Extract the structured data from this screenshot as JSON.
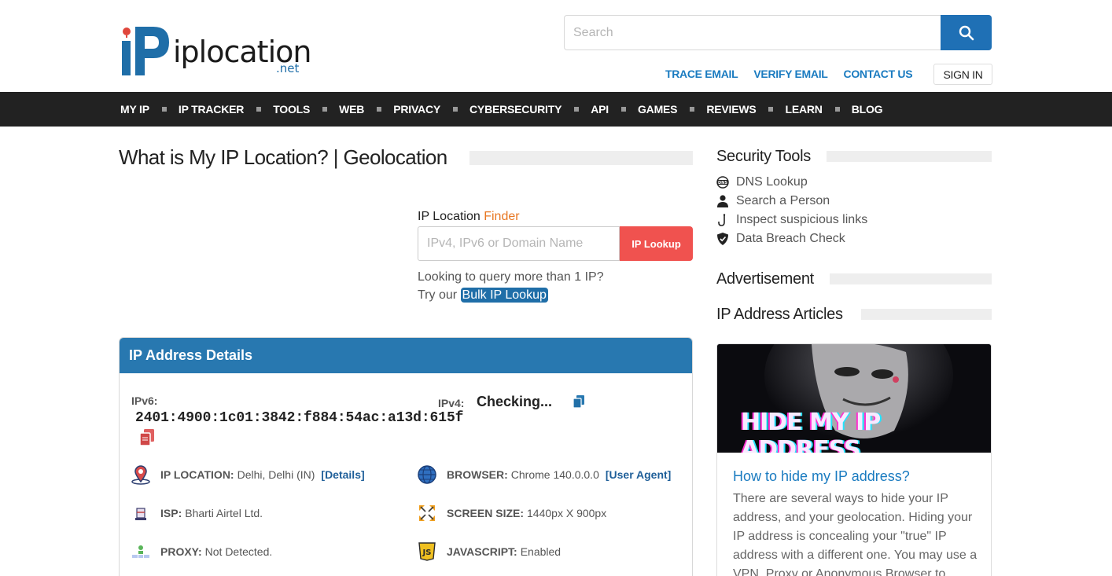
{
  "brand": {
    "name": "iplocation",
    "suffix": ".net"
  },
  "search": {
    "placeholder": "Search"
  },
  "top_links": [
    "TRACE EMAIL",
    "VERIFY EMAIL",
    "CONTACT US"
  ],
  "sign_in": "SIGN IN",
  "nav": [
    "MY IP",
    "IP TRACKER",
    "TOOLS",
    "WEB",
    "PRIVACY",
    "CYBERSECURITY",
    "API",
    "GAMES",
    "REVIEWS",
    "LEARN",
    "BLOG"
  ],
  "main": {
    "title": "What is My IP Location? | Geolocation",
    "finder": {
      "label_prefix": "IP Location ",
      "label_accent": "Finder",
      "placeholder": "IPv4, IPv6 or Domain Name",
      "button": "IP Lookup"
    },
    "bulk": {
      "line1": "Looking to query more than 1 IP?",
      "line2_prefix": "Try our ",
      "link": "Bulk IP Lookup"
    }
  },
  "details": {
    "header": "IP Address Details",
    "ipv6_label": "IPv6:",
    "ipv6_value": "2401:4900:1c01:3842:f884:54ac:a13d:615f",
    "ipv4_label": "IPv4:",
    "ipv4_value": "Checking...",
    "ip_location_label": "IP LOCATION:",
    "ip_location_value": "Delhi, Delhi (IN)",
    "ip_location_link": "[Details]",
    "browser_label": "BROWSER:",
    "browser_value": "Chrome 140.0.0.0",
    "browser_link": "[User Agent]",
    "isp_label": "ISP:",
    "isp_value": "Bharti Airtel Ltd.",
    "screen_label": "SCREEN SIZE:",
    "screen_value": "1440px X 900px",
    "proxy_label": "PROXY:",
    "proxy_value": "Not Detected.",
    "js_label": "JAVASCRIPT:",
    "js_value": "Enabled"
  },
  "sidebar": {
    "security_title": "Security Tools",
    "tools": [
      {
        "label": "DNS Lookup",
        "icon": "dns-icon"
      },
      {
        "label": "Search a Person",
        "icon": "person-icon"
      },
      {
        "label": "Inspect suspicious links",
        "icon": "hook-icon"
      },
      {
        "label": "Data Breach Check",
        "icon": "shield-icon"
      }
    ],
    "ad_title": "Advertisement",
    "articles_title": "IP Address Articles",
    "article": {
      "image_text": "HIDE MY IP ADDRESS",
      "title": "How to hide my IP address?",
      "body": "There are several ways to hide your IP address, and your geolocation. Hiding your IP address is concealing your \"true\" IP address with a different one. You may use a VPN, Proxy or Anonymous Browser to"
    }
  },
  "colors": {
    "brand_blue": "#1f70b5",
    "nav_bg": "#222222",
    "lookup_red": "#f0524f",
    "card_header": "#2878b0",
    "finder_accent": "#e87722"
  }
}
